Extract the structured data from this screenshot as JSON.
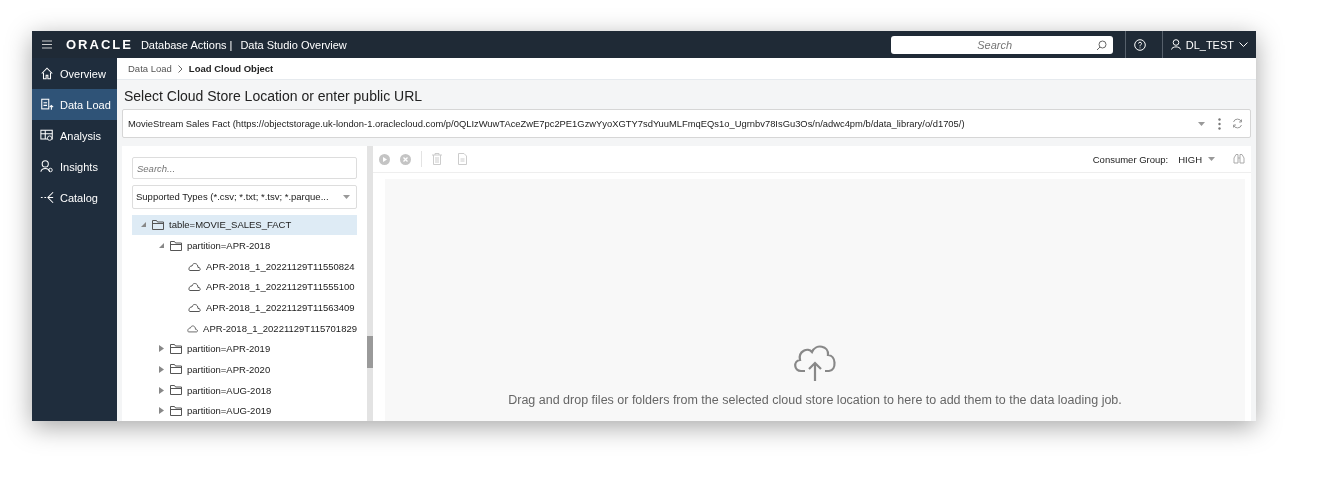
{
  "header": {
    "logo": "ORACLE",
    "product": "Database Actions |",
    "page": "Data Studio Overview",
    "search": {
      "placeholder": "Search"
    },
    "user": "DL_TEST"
  },
  "sidebar": {
    "items": [
      {
        "label": "Overview",
        "kind": "home",
        "selected": false
      },
      {
        "label": "Data Load",
        "kind": "load",
        "selected": true
      },
      {
        "label": "Analysis",
        "kind": "analysis",
        "selected": false
      },
      {
        "label": "Insights",
        "kind": "insights",
        "selected": false
      },
      {
        "label": "Catalog",
        "kind": "catalog",
        "selected": false
      }
    ]
  },
  "breadcrumb": [
    "Data Load",
    "Load Cloud Object"
  ],
  "title": "Select Cloud Store Location or enter public URL",
  "location": {
    "value": "MovieStream Sales Fact (https://objectstorage.uk-london-1.oraclecloud.com/p/0QLIzWuwTAceZwE7pc2PE1GzwYyoXGTY7sdYuuMLFmqEQs1o_Ugrnbv78IsGu3Os/n/adwc4pm/b/data_library/o/d1705/)"
  },
  "tree_panel": {
    "search": {
      "placeholder": "Search..."
    },
    "filter": "Supported Types (*.csv; *.txt; *.tsv; *.parque...",
    "tree": [
      {
        "label": "table=MOVIE_SALES_FACT",
        "kind": "folder",
        "expanded": true,
        "selected": true,
        "children": [
          {
            "label": "partition=APR-2018",
            "kind": "folder",
            "expanded": true,
            "selected": false,
            "children": [
              {
                "label": "APR-2018_1_20221129T11550824",
                "kind": "file",
                "selected": false
              },
              {
                "label": "APR-2018_1_20221129T11555100",
                "kind": "file",
                "selected": false
              },
              {
                "label": "APR-2018_1_20221129T11563409",
                "kind": "file",
                "selected": false
              },
              {
                "label": "APR-2018_1_20221129T115701829",
                "kind": "file",
                "selected": false
              }
            ]
          },
          {
            "label": "partition=APR-2019",
            "kind": "folder",
            "expanded": false,
            "selected": false
          },
          {
            "label": "partition=APR-2020",
            "kind": "folder",
            "expanded": false,
            "selected": false
          },
          {
            "label": "partition=AUG-2018",
            "kind": "folder",
            "expanded": false,
            "selected": false
          },
          {
            "label": "partition=AUG-2019",
            "kind": "folder",
            "expanded": false,
            "selected": false
          }
        ]
      }
    ]
  },
  "job_panel": {
    "consumer_group_label": "Consumer Group:",
    "consumer_group": "HIGH",
    "drop_hint": "Drag and drop files or folders from the selected cloud store location to here to add them to the data loading job."
  }
}
